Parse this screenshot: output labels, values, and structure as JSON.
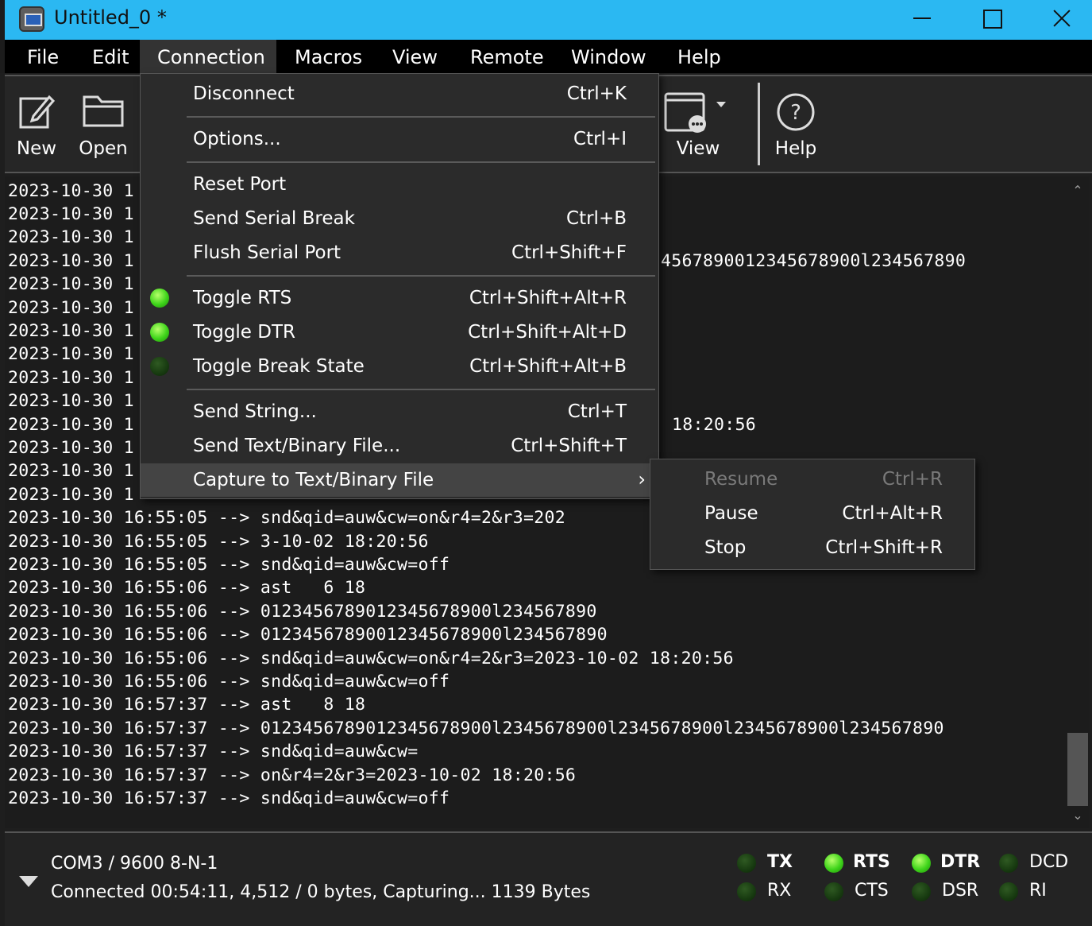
{
  "window": {
    "title": "Untitled_0 *"
  },
  "menubar": {
    "items": [
      "File",
      "Edit",
      "Connection",
      "Macros",
      "View",
      "Remote",
      "Window",
      "Help"
    ],
    "active": "Connection"
  },
  "toolbar": {
    "new_label": "New",
    "open_label": "Open",
    "view_label": "View",
    "help_label": "Help"
  },
  "connection_menu": {
    "items": [
      {
        "label": "Disconnect",
        "shortcut": "Ctrl+K"
      },
      {
        "label": "Options...",
        "shortcut": "Ctrl+I"
      },
      {
        "label": "Reset Port",
        "shortcut": ""
      },
      {
        "label": "Send Serial Break",
        "shortcut": "Ctrl+B"
      },
      {
        "label": "Flush Serial Port",
        "shortcut": "Ctrl+Shift+F"
      },
      {
        "label": "Toggle RTS",
        "shortcut": "Ctrl+Shift+Alt+R",
        "state": "on"
      },
      {
        "label": "Toggle DTR",
        "shortcut": "Ctrl+Shift+Alt+D",
        "state": "on"
      },
      {
        "label": "Toggle Break State",
        "shortcut": "Ctrl+Shift+Alt+B",
        "state": "off"
      },
      {
        "label": "Send String...",
        "shortcut": "Ctrl+T"
      },
      {
        "label": "Send Text/Binary File...",
        "shortcut": "Ctrl+Shift+T"
      },
      {
        "label": "Capture to Text/Binary File",
        "shortcut": ""
      }
    ]
  },
  "capture_submenu": {
    "items": [
      {
        "label": "Resume",
        "shortcut": "Ctrl+R",
        "disabled": true
      },
      {
        "label": "Pause",
        "shortcut": "Ctrl+Alt+R",
        "disabled": false
      },
      {
        "label": "Stop",
        "shortcut": "Ctrl+Shift+R",
        "disabled": false
      }
    ]
  },
  "log": {
    "lines": [
      "2023-10-30 1",
      "2023-10-30 1",
      "2023-10-30 1",
      "2023-10-30 1",
      "2023-10-30 1",
      "2023-10-30 1",
      "2023-10-30 1",
      "2023-10-30 1",
      "2023-10-30 1",
      "2023-10-30 1",
      "2023-10-30 1",
      "2023-10-30 1",
      "2023-10-30 1",
      "2023-10-30 1",
      "2023-10-30 16:55:05 --> snd&qid=auw&cw=on&r4=2&r3=202",
      "2023-10-30 16:55:05 --> 3-10-02 18:20:56",
      "2023-10-30 16:55:05 --> snd&qid=auw&cw=off",
      "2023-10-30 16:55:06 --> ast   6 18",
      "2023-10-30 16:55:06 --> 0123456789012345678900l234567890",
      "2023-10-30 16:55:06 --> 01234567890012345678900l234567890",
      "2023-10-30 16:55:06 --> snd&qid=auw&cw=on&r4=2&r3=2023-10-02 18:20:56",
      "2023-10-30 16:55:06 --> snd&qid=auw&cw=off",
      "2023-10-30 16:57:37 --> ast   8 18",
      "2023-10-30 16:57:37 --> 0123456789012345678900l2345678900l2345678900l2345678900l234567890",
      "2023-10-30 16:57:37 --> snd&qid=auw&cw=",
      "2023-10-30 16:57:37 --> on&r4=2&r3=2023-10-02 18:20:56",
      "2023-10-30 16:57:37 --> snd&qid=auw&cw=off"
    ],
    "visible_fragments": [
      "4567890012345678900l234567890",
      "18:20:56"
    ]
  },
  "status": {
    "port": "COM3 / 9600 8-N-1",
    "connection": "Connected 00:54:11, 4,512 / 0 bytes, Capturing... 1139 Bytes"
  },
  "signals": [
    {
      "label": "TX",
      "state": "off",
      "bold": true
    },
    {
      "label": "RX",
      "state": "off",
      "bold": false
    },
    {
      "label": "RTS",
      "state": "on",
      "bold": true
    },
    {
      "label": "CTS",
      "state": "off",
      "bold": false
    },
    {
      "label": "DTR",
      "state": "on",
      "bold": true
    },
    {
      "label": "DSR",
      "state": "off",
      "bold": false
    },
    {
      "label": "DCD",
      "state": "off",
      "bold": false
    },
    {
      "label": "RI",
      "state": "off",
      "bold": false
    }
  ],
  "colors": {
    "titlebar": "#2bb8f2",
    "led_on": "#3ed41a",
    "led_off": "#173a10"
  }
}
